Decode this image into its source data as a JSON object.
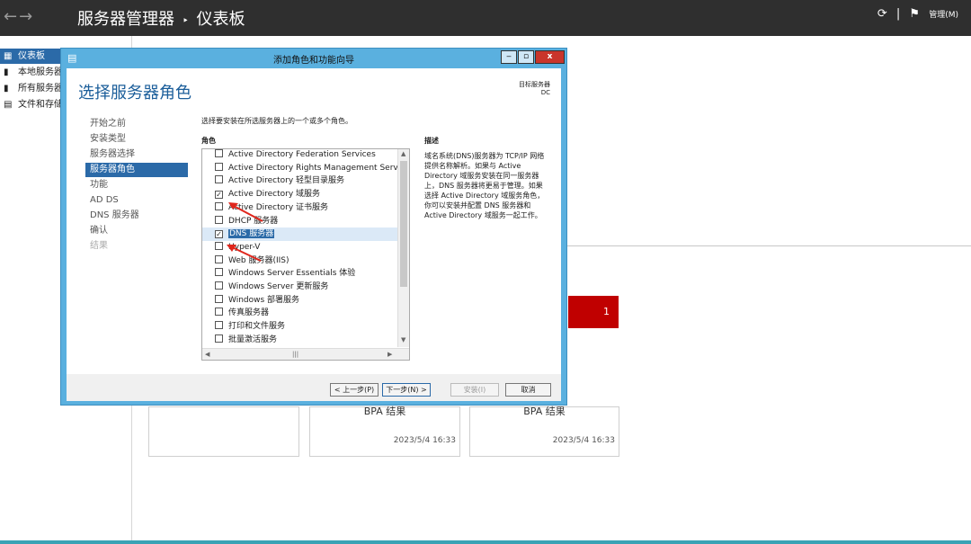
{
  "topbar": {
    "nav_back": "←",
    "nav_fwd": "→",
    "breadcrumb_root": "服务器管理器",
    "breadcrumb_sep": "‣",
    "breadcrumb_current": "仪表板",
    "refresh_icon": "⟳",
    "flag_icon": "⚑",
    "manage": "管理(M)"
  },
  "sidebar": {
    "items": [
      {
        "label": "仪表板",
        "icon": "dashboard-icon",
        "active": true
      },
      {
        "label": "本地服务器",
        "icon": "server-icon"
      },
      {
        "label": "所有服务器",
        "icon": "servers-icon"
      },
      {
        "label": "文件和存储",
        "icon": "storage-icon"
      }
    ]
  },
  "background": {
    "tiles": [
      {
        "caption": "",
        "timestamp": ""
      },
      {
        "caption": "BPA 结果",
        "timestamp": "2023/5/4 16:33"
      },
      {
        "caption": "BPA 结果",
        "timestamp": "2023/5/4 16:33"
      }
    ],
    "red_badge": "1"
  },
  "dialog": {
    "title": "添加角色和功能向导",
    "minimize": "‒",
    "maximize": "▫",
    "close": "x",
    "heading": "选择服务器角色",
    "target_label": "目标服务器",
    "target_value": "DC",
    "steps": [
      {
        "label": "开始之前"
      },
      {
        "label": "安装类型"
      },
      {
        "label": "服务器选择"
      },
      {
        "label": "服务器角色",
        "active": true
      },
      {
        "label": "功能"
      },
      {
        "label": "AD DS"
      },
      {
        "label": "DNS 服务器"
      },
      {
        "label": "确认"
      },
      {
        "label": "结果",
        "dim": true
      }
    ],
    "instruction": "选择要安装在所选服务器上的一个或多个角色。",
    "roles_header": "角色",
    "description_header": "描述",
    "description": "域名系统(DNS)服务器为 TCP/IP 网络提供名称解析。如果与 Active Directory 域服务安装在同一服务器上，DNS 服务器将更易于管理。如果选择 Active Directory 域服务角色，你可以安装并配置 DNS 服务器和 Active Directory 域服务一起工作。",
    "roles": [
      {
        "label": "Active Directory Federation Services",
        "checked": false
      },
      {
        "label": "Active Directory Rights Management Services",
        "checked": false
      },
      {
        "label": "Active Directory 轻型目录服务",
        "checked": false
      },
      {
        "label": "Active Directory 域服务",
        "checked": true
      },
      {
        "label": "Active Directory 证书服务",
        "checked": false
      },
      {
        "label": "DHCP 服务器",
        "checked": false
      },
      {
        "label": "DNS 服务器",
        "checked": true,
        "selected": true
      },
      {
        "label": "Hyper-V",
        "checked": false
      },
      {
        "label": "Web 服务器(IIS)",
        "checked": false
      },
      {
        "label": "Windows Server Essentials 体验",
        "checked": false
      },
      {
        "label": "Windows Server 更新服务",
        "checked": false
      },
      {
        "label": "Windows 部署服务",
        "checked": false
      },
      {
        "label": "传真服务器",
        "checked": false
      },
      {
        "label": "打印和文件服务",
        "checked": false
      },
      {
        "label": "批量激活服务",
        "checked": false
      }
    ],
    "check_mark": "✓",
    "buttons": {
      "prev": "< 上一步(P)",
      "next": "下一步(N) >",
      "install": "安装(I)",
      "cancel": "取消"
    }
  },
  "colors": {
    "accent": "#2b6aa8",
    "dialog_frame": "#5ab0df",
    "badge_red": "#c00000",
    "arrow_red": "#e0261c"
  }
}
